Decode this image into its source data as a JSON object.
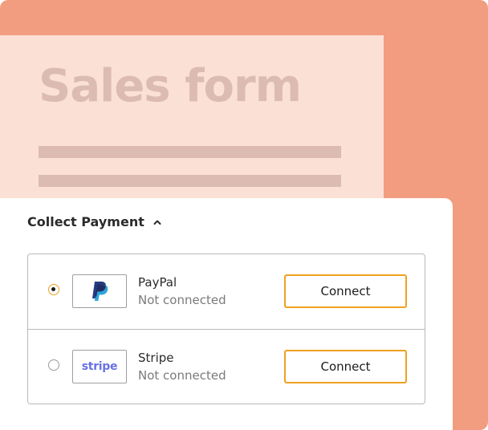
{
  "preview": {
    "title": "Sales form"
  },
  "panel": {
    "title": "Collect Payment",
    "toggle_icon": "chevron-up-icon"
  },
  "options": [
    {
      "provider": "PayPal",
      "logo_icon": "paypal-logo-icon",
      "status": "Not connected",
      "selected": true,
      "connect_label": "Connect"
    },
    {
      "provider": "Stripe",
      "logo_text": "stripe",
      "status": "Not connected",
      "selected": false,
      "connect_label": "Connect"
    }
  ],
  "colors": {
    "background_accent": "#f29d80",
    "preview_fill": "#fbe0d6",
    "preview_text": "#dbbbb2",
    "button_border": "#f0a020",
    "stripe_brand": "#6772e5",
    "paypal_dark": "#253b80",
    "paypal_light": "#179bd7"
  }
}
